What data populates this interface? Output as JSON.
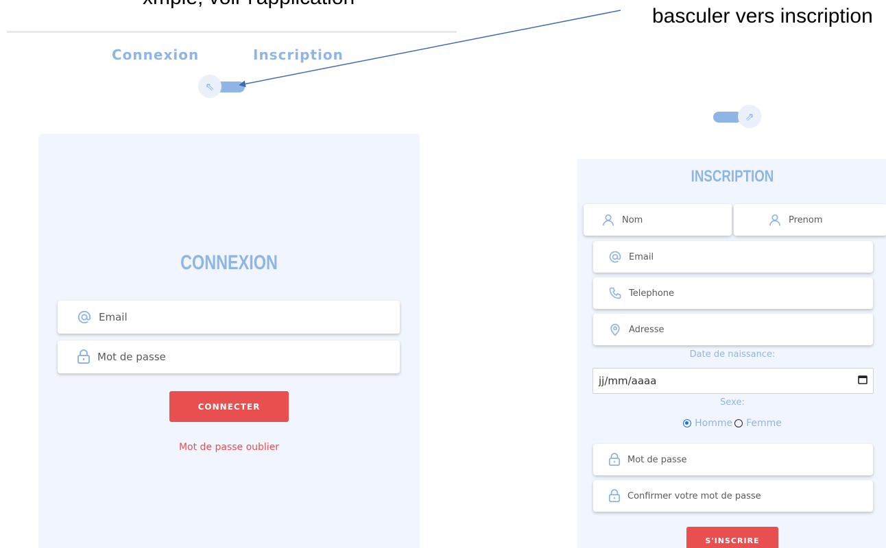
{
  "annotation": {
    "cut_text": "xmple, voir l'application",
    "label": "basculer vers inscription"
  },
  "nav": {
    "tab_connexion": "Connexion",
    "tab_inscription": "Inscription"
  },
  "toggles": {
    "left_arrow": "⇖",
    "right_arrow": "⇗"
  },
  "login": {
    "title": "CONNEXION",
    "email_placeholder": "Email",
    "password_placeholder": "Mot de passe",
    "submit_label": "CONNECTER",
    "forgot_label": "Mot de passe oublier"
  },
  "signup": {
    "title": "INSCRIPTION",
    "nom_placeholder": "Nom",
    "prenom_placeholder": "Prenom",
    "email_placeholder": "Email",
    "telephone_placeholder": "Telephone",
    "adresse_placeholder": "Adresse",
    "dob_label": "Date de naissance:",
    "dob_value": "jj/mm/aaaa",
    "sexe_label": "Sexe:",
    "gender_options": [
      "Homme",
      "Femme"
    ],
    "gender_selected": "Homme",
    "password_placeholder": "Mot de passe",
    "confirm_placeholder": "Confirmer votre mot de passe",
    "submit_label": "S'INSCRIRE"
  },
  "colors": {
    "accent_blue": "#8fb5e6",
    "panel_bg": "#f1f6fe",
    "button_red": "#e85050",
    "arrow": "#3c6db0"
  },
  "icons": {
    "email": "at-icon",
    "password": "lock-icon",
    "user": "user-icon",
    "phone": "phone-icon",
    "address": "location-pin-icon",
    "calendar": "calendar-icon"
  }
}
